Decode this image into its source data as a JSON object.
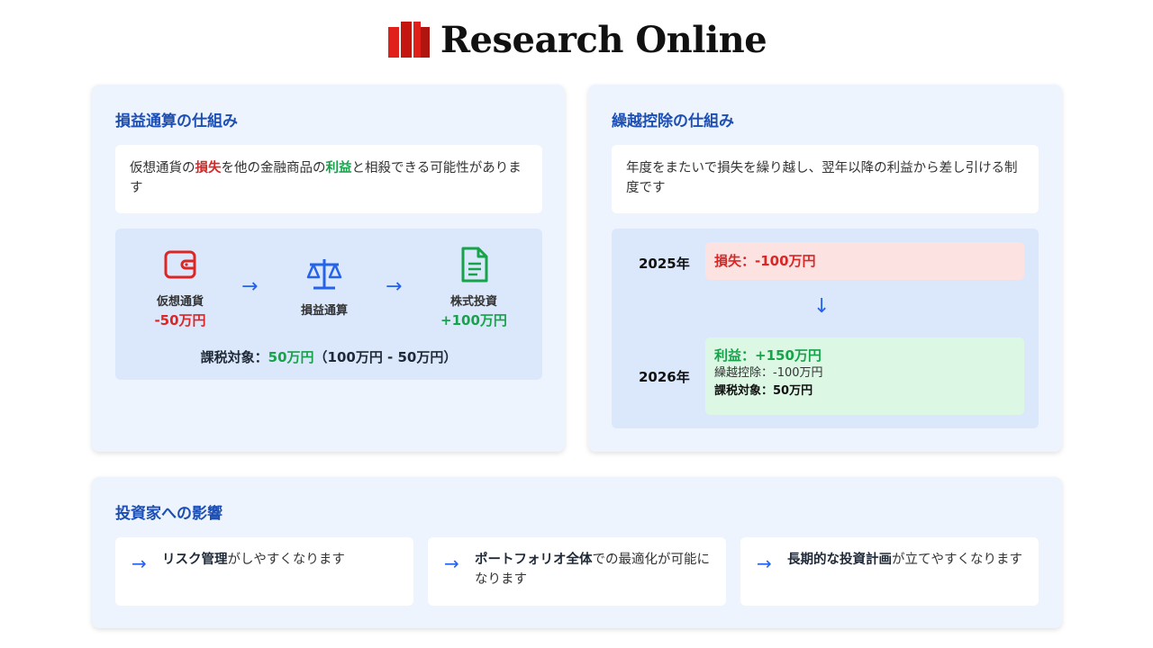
{
  "brand": {
    "name": "Research Online",
    "colors": {
      "red": "#e0201b",
      "dark_red": "#b0150f"
    }
  },
  "left_card": {
    "title": "損益通算の仕組み",
    "desc": {
      "p1": "仮想通貨の",
      "loss": "損失",
      "p2": "を他の金融商品の",
      "profit": "利益",
      "p3": "と相殺できる可能性があります"
    },
    "flow": [
      {
        "icon": "wallet-icon",
        "label": "仮想通貨",
        "value": "-50万円"
      },
      {
        "icon": "scale-icon",
        "label": "損益通算",
        "value": ""
      },
      {
        "icon": "document-icon",
        "label": "株式投資",
        "value": "+100万円"
      }
    ],
    "taxable": {
      "label": "課税対象：",
      "value": "50万円",
      "note": "（100万円 - 50万円）"
    }
  },
  "right_card": {
    "title": "繰越控除の仕組み",
    "desc": "年度をまたいで損失を繰り越し、翌年以降の利益から差し引ける制度です",
    "timeline": [
      {
        "year": "2025年",
        "line1": "損失：-100万円"
      },
      {
        "year": "2026年",
        "line1": "利益：+150万円",
        "line2": "繰越控除：-100万円",
        "line3": "課税対象：50万円"
      }
    ]
  },
  "bottom_card": {
    "title": "投資家への影響",
    "items": [
      {
        "bold": "リスク管理",
        "rest": "がしやすくなります"
      },
      {
        "bold": "ポートフォリオ全体",
        "rest": "での最適化が可能になります"
      },
      {
        "bold": "長期的な投資計画",
        "rest": "が立てやすくなります"
      }
    ]
  },
  "colors": {
    "title_blue": "#1d4fb3",
    "loss_red": "#dc2626",
    "gain_green": "#16a34a",
    "arrow_blue": "#2563eb"
  }
}
